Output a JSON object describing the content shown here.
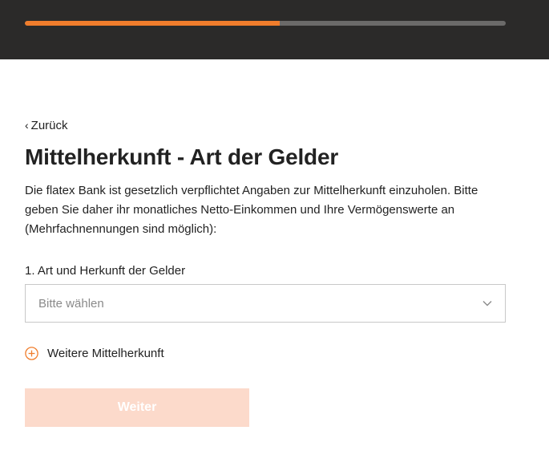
{
  "progress": {
    "percent": 53,
    "fill_color": "#f07d2c",
    "track_color": "#6b6a69"
  },
  "back_link": {
    "chevron": "‹",
    "label": "Zurück"
  },
  "page_title": "Mittelherkunft - Art der Gelder",
  "description": "Die flatex Bank ist gesetzlich verpflichtet Angaben zur Mittelherkunft einzuholen. Bitte geben Sie daher ihr monatliches Netto-Einkommen und Ihre Vermögenswerte an (Mehrfachnennungen sind möglich):",
  "fields": {
    "source_label": "1. Art und Herkunft der Gelder",
    "source_select": {
      "placeholder": "Bitte wählen",
      "icon": "chevron-down-icon"
    }
  },
  "add_more": {
    "icon": "plus-circle-icon",
    "label": "Weitere Mittelherkunft",
    "icon_color": "#f07d2c"
  },
  "submit": {
    "label": "Weiter",
    "background_color": "#fcdacb",
    "disabled": true
  }
}
